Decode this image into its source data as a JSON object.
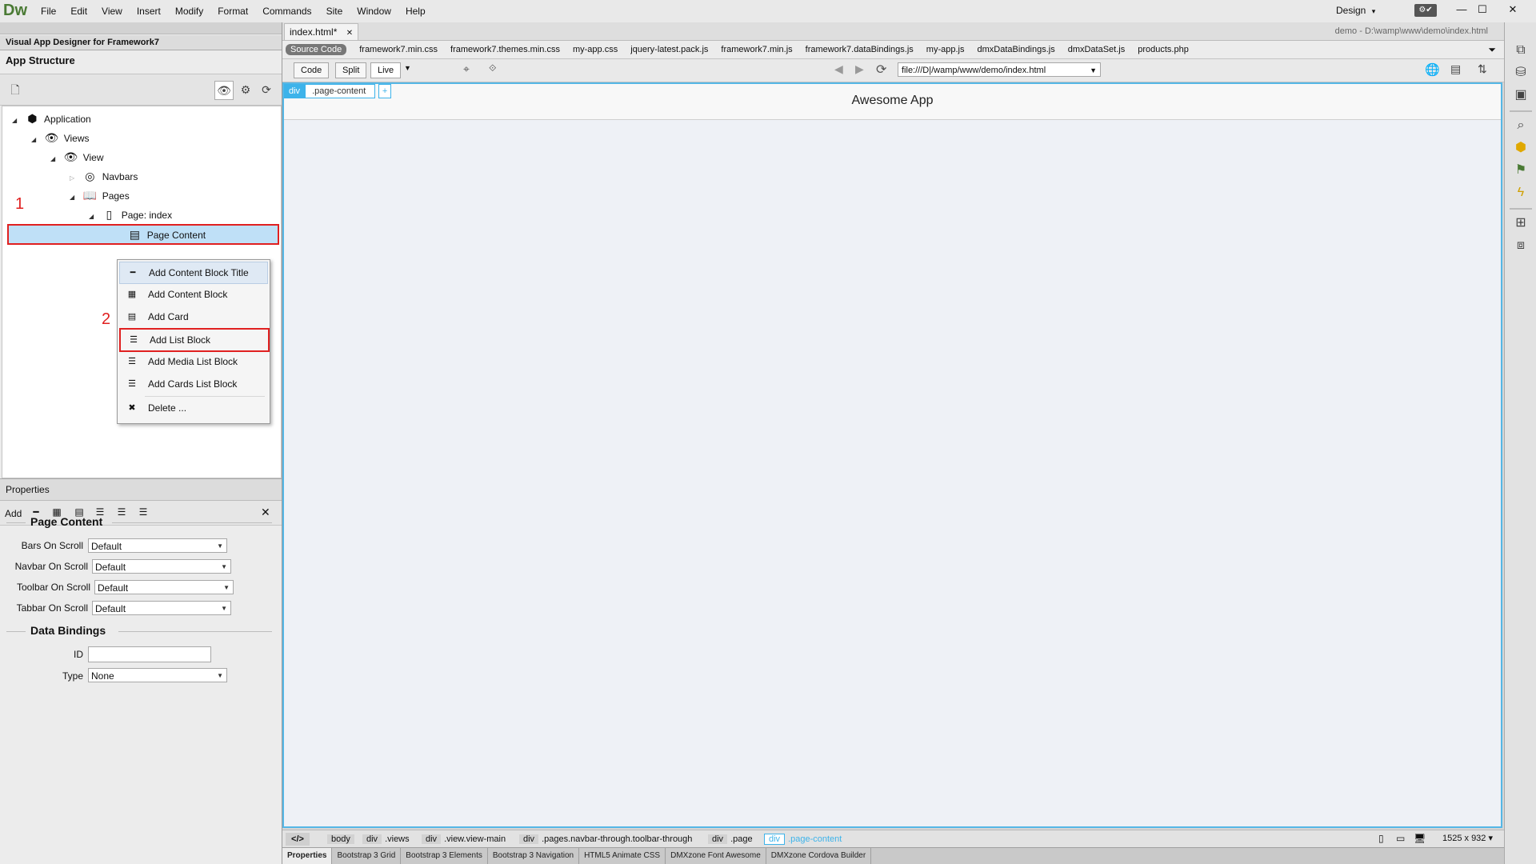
{
  "app": {
    "logo": "Dw",
    "workspace": "Design",
    "workspace_arrow": "▾",
    "sync": "⚙✔"
  },
  "menu": [
    "File",
    "Edit",
    "View",
    "Insert",
    "Modify",
    "Format",
    "Commands",
    "Site",
    "Window",
    "Help"
  ],
  "window_controls": {
    "minimize": "—",
    "maximize": "☐",
    "close": "✕"
  },
  "left_panel": {
    "title": "Visual App Designer for Framework7",
    "app_structure_heading": "App Structure",
    "tree": {
      "application": "Application",
      "views": "Views",
      "view": "View",
      "navbars": "Navbars",
      "pages": "Pages",
      "page_index": "Page: index",
      "page_content": "Page Content"
    },
    "annotations": [
      "1",
      "2"
    ]
  },
  "context_menu": {
    "items": [
      {
        "label": "Add Content Block Title",
        "icon": "━"
      },
      {
        "label": "Add Content Block",
        "icon": "▦"
      },
      {
        "label": "Add Card",
        "icon": "▤"
      },
      {
        "label": "Add List Block",
        "icon": "☰"
      },
      {
        "label": "Add Media List Block",
        "icon": "☰"
      },
      {
        "label": "Add Cards List Block",
        "icon": "☰"
      },
      {
        "label": "Delete ...",
        "icon": "✖"
      }
    ]
  },
  "properties": {
    "title": "Properties",
    "add_label": "Add",
    "close": "✕",
    "section_page_content": "Page Content",
    "fields": [
      {
        "label": "Bars On Scroll",
        "value": "Default"
      },
      {
        "label": "Navbar On Scroll",
        "value": "Default"
      },
      {
        "label": "Toolbar On Scroll",
        "value": "Default"
      },
      {
        "label": "Tabbar On Scroll",
        "value": "Default"
      }
    ],
    "section_data_bindings": "Data Bindings",
    "id_label": "ID",
    "id_value": "",
    "type_label": "Type",
    "type_value": "None"
  },
  "document": {
    "tab": "index.html*",
    "tab_close": "✕",
    "path": "demo - D:\\wamp\\www\\demo\\index.html",
    "related_files": [
      "Source Code",
      "framework7.min.css",
      "framework7.themes.min.css",
      "my-app.css",
      "jquery-latest.pack.js",
      "framework7.min.js",
      "framework7.dataBindings.js",
      "my-app.js",
      "dmxDataBindings.js",
      "dmxDataSet.js",
      "products.php"
    ],
    "view_buttons": {
      "code": "Code",
      "split": "Split",
      "live": "Live"
    },
    "url": "file:///D|/wamp/www/demo/index.html",
    "selection_tag": "div",
    "selection_class": ".page-content",
    "selection_add": "+",
    "navbar_title": "Awesome App"
  },
  "tag_selector": {
    "code_btn": "</>",
    "items": [
      {
        "tag": "body",
        "cls": ""
      },
      {
        "tag": "div",
        "cls": ".views"
      },
      {
        "tag": "div",
        "cls": ".view.view-main"
      },
      {
        "tag": "div",
        "cls": ".pages.navbar-through.toolbar-through"
      },
      {
        "tag": "div",
        "cls": ".page"
      },
      {
        "tag": "div",
        "cls": ".page-content"
      }
    ],
    "viewport_size": "1525 x 932 ▾"
  },
  "bottom_tabs": [
    "Properties",
    "Bootstrap 3 Grid",
    "Bootstrap 3 Elements",
    "Bootstrap 3 Navigation",
    "HTML5 Animate CSS",
    "DMXzone Font Awesome",
    "DMXzone Cordova Builder"
  ]
}
